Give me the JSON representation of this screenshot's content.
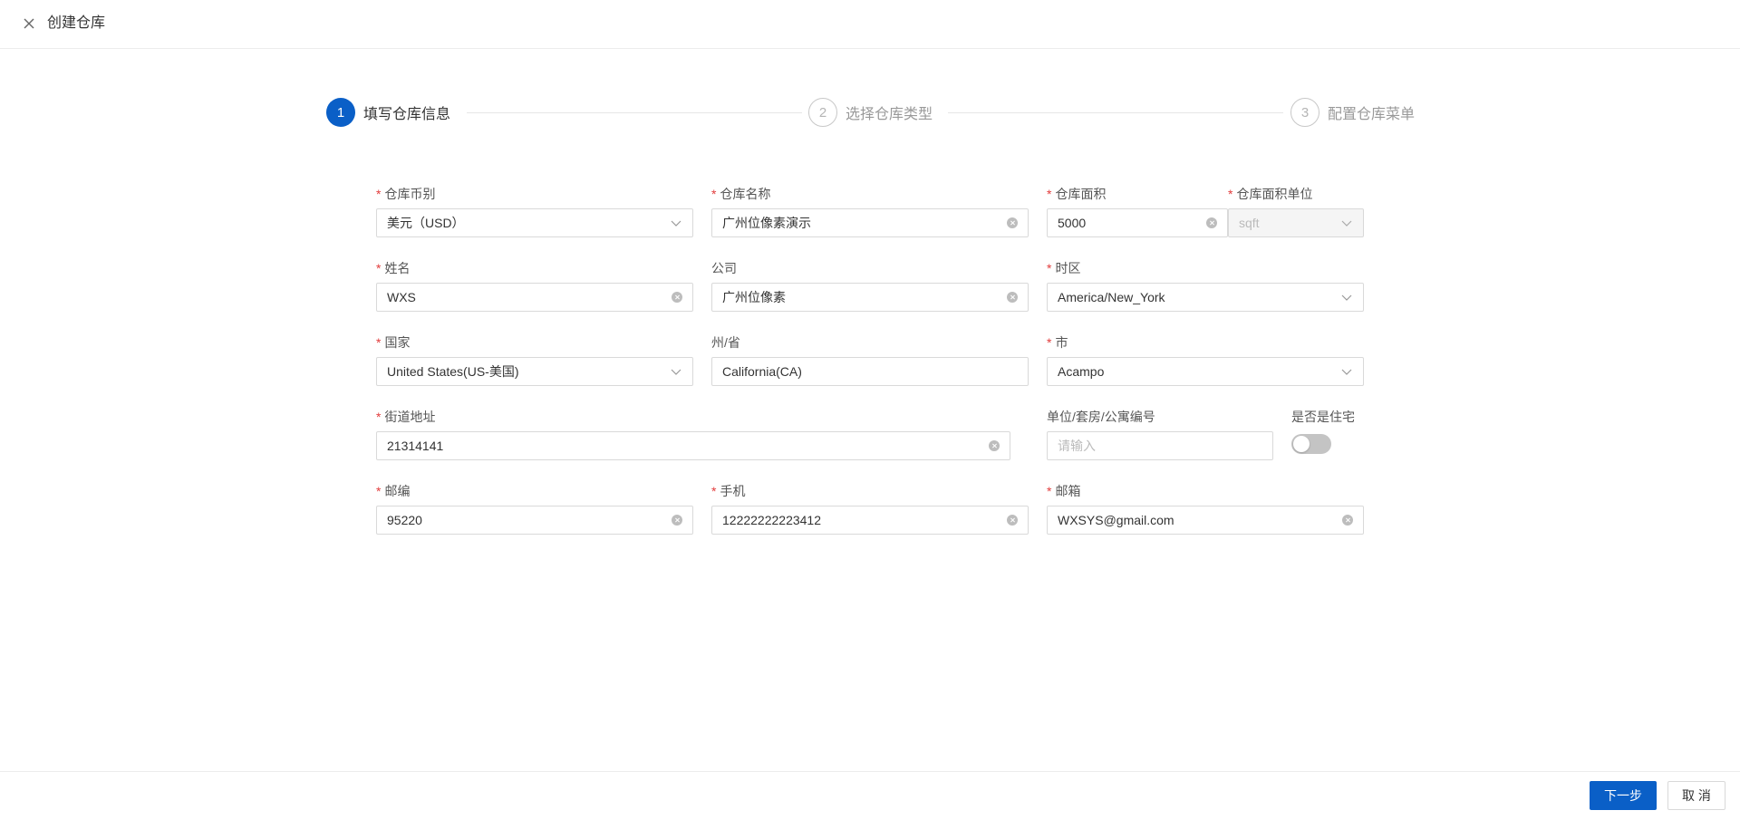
{
  "header": {
    "title": "创建仓库",
    "close_icon": "close-icon"
  },
  "steps": [
    {
      "number": "1",
      "label": "填写仓库信息",
      "status": "active"
    },
    {
      "number": "2",
      "label": "选择仓库类型",
      "status": "pending"
    },
    {
      "number": "3",
      "label": "配置仓库菜单",
      "status": "pending"
    }
  ],
  "form": {
    "currency": {
      "label": "仓库币别",
      "required": true,
      "value": "美元（USD）",
      "type": "select"
    },
    "warehouse_name": {
      "label": "仓库名称",
      "required": true,
      "value": "广州位像素演示",
      "type": "input"
    },
    "area": {
      "label": "仓库面积",
      "required": true,
      "value": "5000",
      "type": "input"
    },
    "area_unit": {
      "label": "仓库面积单位",
      "required": true,
      "value": "sqft",
      "type": "select",
      "disabled": true
    },
    "name": {
      "label": "姓名",
      "required": true,
      "value": "WXS",
      "type": "input"
    },
    "company": {
      "label": "公司",
      "required": false,
      "value": "广州位像素",
      "type": "input"
    },
    "timezone": {
      "label": "时区",
      "required": true,
      "value": "America/New_York",
      "type": "select"
    },
    "country": {
      "label": "国家",
      "required": true,
      "value": "United States(US-美国)",
      "type": "select"
    },
    "state": {
      "label": "州/省",
      "required": false,
      "value": "California(CA)",
      "type": "input"
    },
    "city": {
      "label": "市",
      "required": true,
      "value": "Acampo",
      "type": "select"
    },
    "street": {
      "label": "街道地址",
      "required": true,
      "value": "21314141",
      "type": "input"
    },
    "unit": {
      "label": "单位/套房/公寓编号",
      "required": false,
      "value": "",
      "placeholder": "请输入",
      "type": "input"
    },
    "residential": {
      "label": "是否是住宅",
      "required": false,
      "checked": false,
      "type": "switch"
    },
    "zipcode": {
      "label": "邮编",
      "required": true,
      "value": "95220",
      "type": "input"
    },
    "phone": {
      "label": "手机",
      "required": true,
      "value": "12222222223412",
      "type": "input"
    },
    "email": {
      "label": "邮箱",
      "required": true,
      "value": "WXSYS@gmail.com",
      "type": "input"
    }
  },
  "footer": {
    "next_label": "下一步",
    "cancel_label": "取 消"
  },
  "colors": {
    "primary": "#0a5fc7",
    "required": "#e23c3c"
  }
}
